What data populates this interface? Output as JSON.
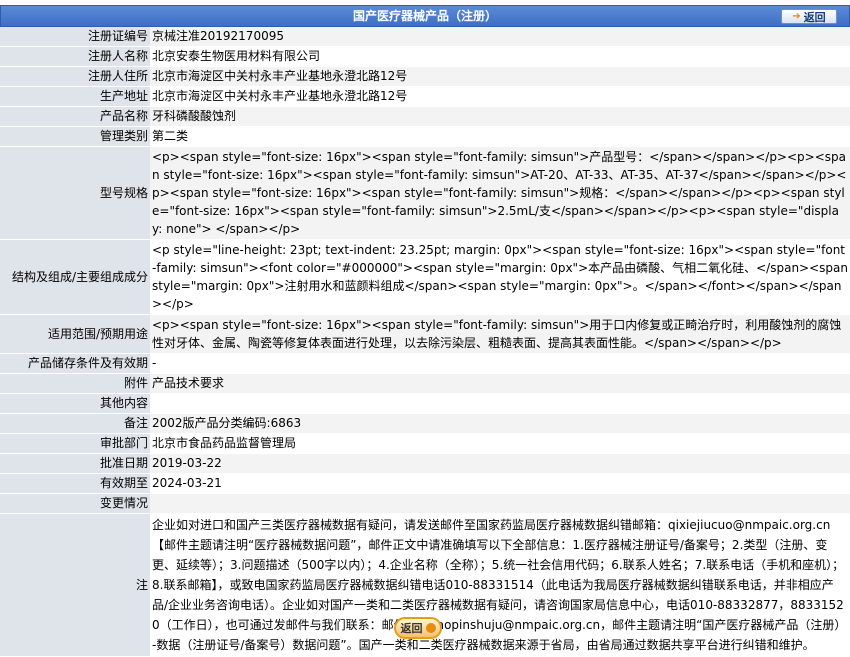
{
  "header": {
    "title": "国产医疗器械产品（注册）",
    "back_label": "返回"
  },
  "fields": [
    {
      "label": "注册证编号",
      "value": "京械注准20192170095"
    },
    {
      "label": "注册人名称",
      "value": "北京安泰生物医用材料有限公司"
    },
    {
      "label": "注册人住所",
      "value": "北京市海淀区中关村永丰产业基地永澄北路12号"
    },
    {
      "label": "生产地址",
      "value": "北京市海淀区中关村永丰产业基地永澄北路12号"
    },
    {
      "label": "产品名称",
      "value": "牙科磷酸酸蚀剂"
    },
    {
      "label": "管理类别",
      "value": "第二类"
    },
    {
      "label": "型号规格",
      "value": "<p><span style=\"font-size: 16px\"><span style=\"font-family: simsun\">产品型号：</span></span></p><p><span style=\"font-size: 16px\"><span style=\"font-family: simsun\">AT-20、AT-33、AT-35、AT-37</span></span></p><p><span style=\"font-size: 16px\"><span style=\"font-family: simsun\">规格：</span></span></p><p><span style=\"font-size: 16px\"><span style=\"font-family: simsun\">2.5mL/支</span></span></p><p><span style=\"display: none\"> </span></p>"
    },
    {
      "label": "结构及组成/主要组成成分",
      "value": "<p style=\"line-height: 23pt; text-indent: 23.25pt; margin: 0px\"><span style=\"font-size: 16px\"><span style=\"font-family: simsun\"><font color=\"#000000\"><span style=\"margin: 0px\">本产品由磷酸、气相二氧化硅、</span><span style=\"margin: 0px\">注射用水和蓝颜料组成</span><span style=\"margin: 0px\">。</span></font></span></span></p>"
    },
    {
      "label": "适用范围/预期用途",
      "value": "<p><span style=\"font-size: 16px\"><span style=\"font-family: simsun\">用于口内修复或正畸治疗时，利用酸蚀剂的腐蚀性对牙体、金属、陶瓷等修复体表面进行处理，以去除污染层、粗糙表面、提高其表面性能。</span></span></p>"
    },
    {
      "label": "产品储存条件及有效期",
      "value": "-"
    },
    {
      "label": "附件",
      "value": "产品技术要求"
    },
    {
      "label": "其他内容",
      "value": ""
    },
    {
      "label": "备注",
      "value": "2002版产品分类编码:6863"
    },
    {
      "label": "审批部门",
      "value": "北京市食品药品监督管理局"
    },
    {
      "label": "批准日期",
      "value": "2019-03-22"
    },
    {
      "label": "有效期至",
      "value": "2024-03-21"
    },
    {
      "label": "变更情况",
      "value": ""
    },
    {
      "label": "注",
      "value": "企业如对进口和国产三类医疗器械数据有疑问，请发送邮件至国家药监局医疗器械数据纠错邮箱：qixiejiucuo@nmpaic.org.cn【邮件主题请注明“医疗器械数据问题”，邮件正文中请准确填写以下全部信息：1.医疗器械注册证号/备案号；2.类型（注册、变更、延续等）；3.问题描述（500字以内）；4.企业名称（全称）；5.统一社会信用代码；6.联系人姓名；7.联系电话（手机和座机）；8.联系邮箱】，或致电国家药监局医疗器械数据纠错电话010-88331514（此电话为我局医疗器械数据纠错联系电话，并非相应产品/企业业务咨询电话）。企业如对国产一类和二类医疗器械数据有疑问，请咨询国家局信息中心，电话010-88332877，88331520（工作日），也可通过发邮件与我们联系：邮件地址yaopinshuju@nmpaic.org.cn，邮件主题请注明“国产医疗器械产品（注册）-数据（注册证号/备案号）数据问题”。国产一类和二类医疗器械数据来源于省局，由省局通过数据共享平台进行纠错和维护。"
    }
  ],
  "footer": {
    "back_label": "返回"
  }
}
